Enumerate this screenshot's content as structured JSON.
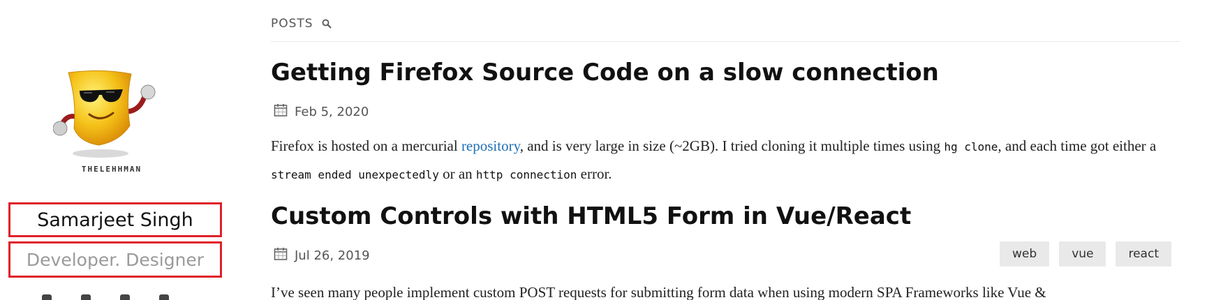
{
  "sidebar": {
    "avatar_caption": "THELEHHMAN",
    "name": "Samarjeet Singh",
    "tagline": "Developer. Designer"
  },
  "nav": {
    "posts_label": "POSTS",
    "search_icon": "search-icon"
  },
  "posts": [
    {
      "title": "Getting Firefox Source Code on a slow connection",
      "date": "Feb 5, 2020",
      "excerpt": {
        "t1": "Firefox is hosted on a mercurial ",
        "link": "repository",
        "t2": ", and is very large in size (~2GB). I tried cloning it multiple times using ",
        "code1": "hg clone",
        "t3": ", and each time got either a ",
        "code2": "stream ended unexpectedly",
        "t4": " or an ",
        "code3": "http connection",
        "t5": " error."
      }
    },
    {
      "title": "Custom Controls with HTML5 Form in Vue/React",
      "date": "Jul 26, 2019",
      "tags": [
        "web",
        "vue",
        "react"
      ],
      "excerpt": {
        "t1": "I’ve seen many people implement custom POST requests for submitting form data when using modern SPA Frameworks like Vue &"
      }
    }
  ],
  "colors": {
    "link": "#1f6fb4",
    "highlight_border": "#e0202a"
  }
}
